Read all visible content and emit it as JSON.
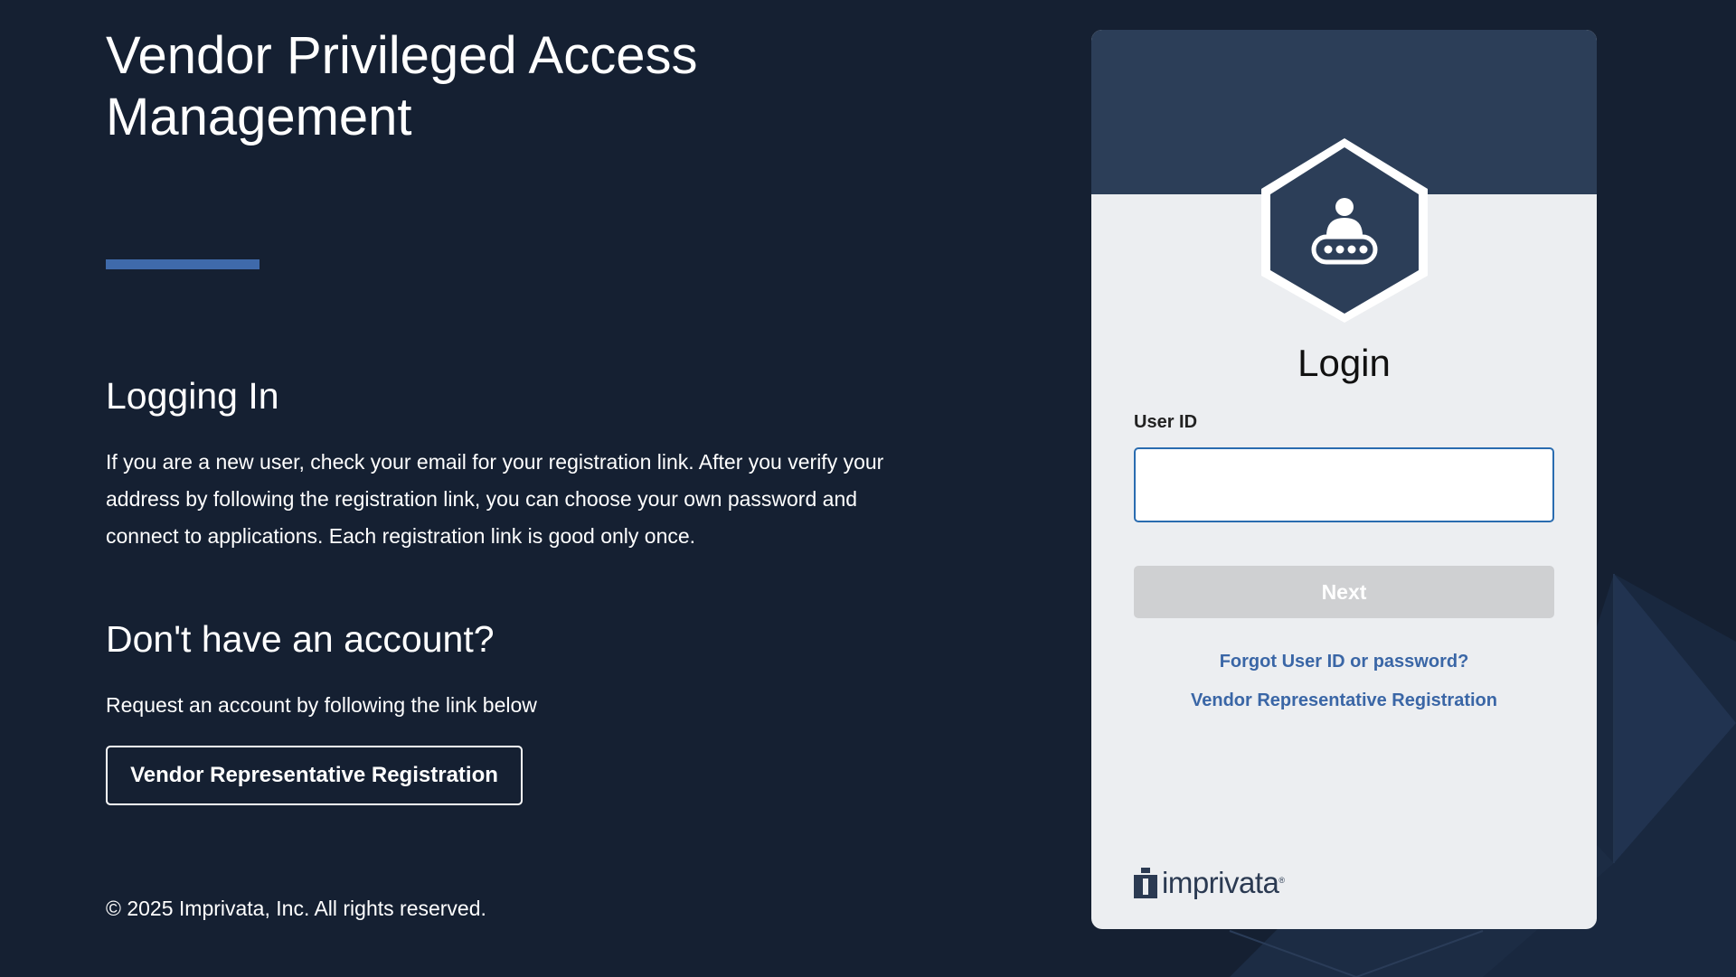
{
  "colors": {
    "background": "#152032",
    "accent_bar": "#3f6aab",
    "card_header": "#2c3e58",
    "card_body": "#eceef1",
    "link": "#3a66a6",
    "input_border": "#2a6cb0",
    "next_button_disabled": "#cfd0d2"
  },
  "left_panel": {
    "title": "Vendor Privileged Access Management",
    "logging_in": {
      "heading": "Logging In",
      "body": "If you are a new user, check your email for your registration link. After you verify your address by following the registration link, you can choose your own password and connect to applications. Each registration link is good only once."
    },
    "no_account": {
      "heading": "Don't have an account?",
      "body": "Request an account by following the link below",
      "button_label": "Vendor Representative Registration"
    },
    "copyright": "© 2025 Imprivata, Inc. All rights reserved."
  },
  "login_card": {
    "badge_icon": "vendor-user-icon",
    "title": "Login",
    "user_id_label": "User ID",
    "user_id_value": "",
    "next_label": "Next",
    "forgot_link": "Forgot User ID or password?",
    "registration_link": "Vendor Representative Registration",
    "brand_name": "imprivata",
    "brand_mark": "®"
  }
}
